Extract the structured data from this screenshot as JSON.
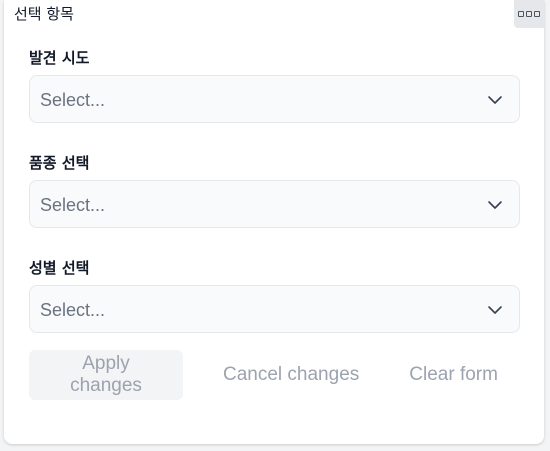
{
  "panel": {
    "title": "선택 항목",
    "more_icon": "more-options-icon"
  },
  "fields": [
    {
      "label": "발견 시도",
      "value": "",
      "placeholder": "Select..."
    },
    {
      "label": "품종 선택",
      "value": "",
      "placeholder": "Select..."
    },
    {
      "label": "성별 선택",
      "value": "",
      "placeholder": "Select..."
    }
  ],
  "actions": {
    "apply_label": "Apply changes",
    "cancel_label": "Cancel changes",
    "clear_label": "Clear form"
  },
  "colors": {
    "disabled_text": "#9ca3af",
    "placeholder_text": "#6b7280",
    "select_background": "#f9fafb"
  }
}
